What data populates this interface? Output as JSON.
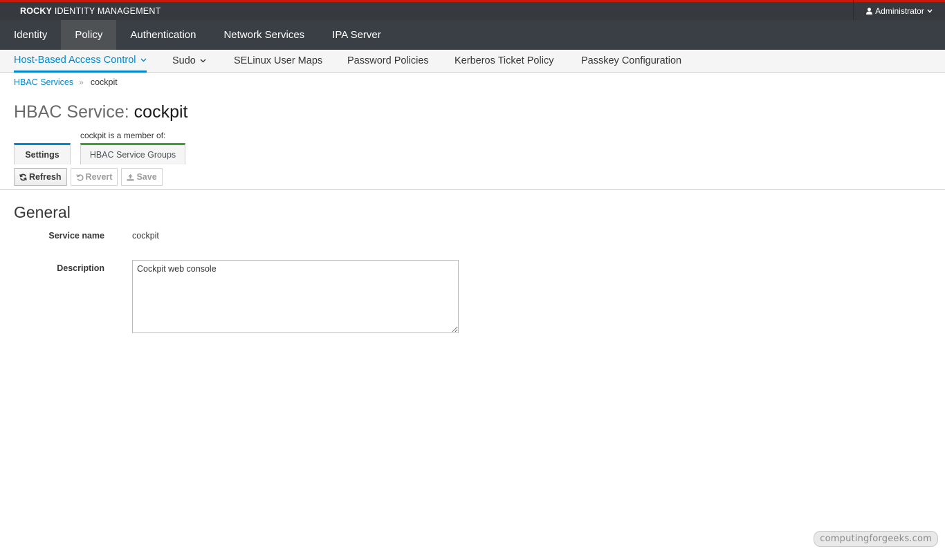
{
  "header": {
    "brand_bold": "ROCKY",
    "brand_rest": " IDENTITY MANAGEMENT",
    "user": "Administrator"
  },
  "primary_nav": [
    {
      "label": "Identity",
      "active": false
    },
    {
      "label": "Policy",
      "active": true
    },
    {
      "label": "Authentication",
      "active": false
    },
    {
      "label": "Network Services",
      "active": false
    },
    {
      "label": "IPA Server",
      "active": false
    }
  ],
  "secondary_nav": [
    {
      "label": "Host-Based Access Control",
      "active": true,
      "dropdown": true
    },
    {
      "label": "Sudo",
      "active": false,
      "dropdown": true
    },
    {
      "label": "SELinux User Maps",
      "active": false,
      "dropdown": false
    },
    {
      "label": "Password Policies",
      "active": false,
      "dropdown": false
    },
    {
      "label": "Kerberos Ticket Policy",
      "active": false,
      "dropdown": false
    },
    {
      "label": "Passkey Configuration",
      "active": false,
      "dropdown": false
    }
  ],
  "breadcrumb": {
    "parent": "HBAC Services",
    "separator": "»",
    "current": "cockpit"
  },
  "title": {
    "prefix": "HBAC Service: ",
    "name": "cockpit"
  },
  "facets": {
    "member_of": "cockpit is a member of:",
    "settings": "Settings",
    "groups": "HBAC Service Groups"
  },
  "actions": {
    "refresh": "Refresh",
    "revert": "Revert",
    "save": "Save"
  },
  "section": {
    "title": "General",
    "service_name_label": "Service name",
    "service_name_value": "cockpit",
    "description_label": "Description",
    "description_value": "Cockpit web console"
  },
  "watermark": "computingforgeeks.com",
  "colors": {
    "accent": "#0088ce",
    "top_border": "#c9190b",
    "groups_tab": "#3f9c35",
    "nav_bg": "#393f44"
  }
}
